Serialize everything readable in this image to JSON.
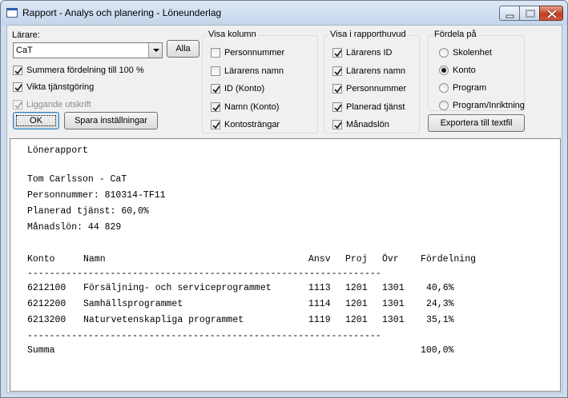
{
  "window": {
    "title": "Rapport - Analys och planering - Löneunderlag"
  },
  "controls": {
    "teacher_label": "Lärare:",
    "teacher_value": "CaT",
    "all_button": "Alla",
    "sum_to_100": {
      "label": "Summera fördelning till 100 %",
      "checked": true
    },
    "weight_service": {
      "label": "Vikta tjänstgöring",
      "checked": true
    },
    "landscape": {
      "label": "Liggande utskrift",
      "checked": true,
      "disabled": true
    },
    "ok_button": "OK",
    "save_settings_button": "Spara inställningar",
    "export_button": "Exportera till textfil"
  },
  "show_columns": {
    "title": "Visa kolumn",
    "items": [
      {
        "label": "Personnummer",
        "checked": false
      },
      {
        "label": "Lärarens namn",
        "checked": false
      },
      {
        "label": "ID (Konto)",
        "checked": true
      },
      {
        "label": "Namn (Konto)",
        "checked": true
      },
      {
        "label": "Kontosträngar",
        "checked": true
      }
    ]
  },
  "report_header": {
    "title": "Visa i rapporthuvud",
    "items": [
      {
        "label": "Lärarens ID",
        "checked": true
      },
      {
        "label": "Lärarens namn",
        "checked": true
      },
      {
        "label": "Personnummer",
        "checked": true
      },
      {
        "label": "Planerad tjänst",
        "checked": true
      },
      {
        "label": "Månadslön",
        "checked": true
      }
    ]
  },
  "distribute": {
    "title": "Fördela på",
    "items": [
      {
        "label": "Skolenhet",
        "selected": false
      },
      {
        "label": "Konto",
        "selected": true
      },
      {
        "label": "Program",
        "selected": false
      },
      {
        "label": "Program/Inriktning",
        "selected": false
      }
    ]
  },
  "report": {
    "heading": "Lönerapport",
    "teacher_line": "Tom Carlsson - CaT",
    "personnummer_line": "Personnummer: 810314-TF11",
    "planned_line": "Planerad tjänst: 60,0%",
    "salary_line": "Månadslön: 44 829",
    "columns": [
      "Konto",
      "Namn",
      "Ansv",
      "Proj",
      "Övr",
      "Fördelning"
    ],
    "separator": "----------------------------------------------------------------",
    "rows": [
      [
        "6212100",
        "Försäljning- och serviceprogrammet",
        "1113",
        "1201",
        "1301",
        "40,6%"
      ],
      [
        "6212200",
        "Samhällsprogrammet",
        "1114",
        "1201",
        "1301",
        "24,3%"
      ],
      [
        "6213200",
        "Naturvetenskapliga programmet",
        "1119",
        "1201",
        "1301",
        "35,1%"
      ]
    ],
    "total_label": "Summa",
    "total_value": "100,0%"
  }
}
